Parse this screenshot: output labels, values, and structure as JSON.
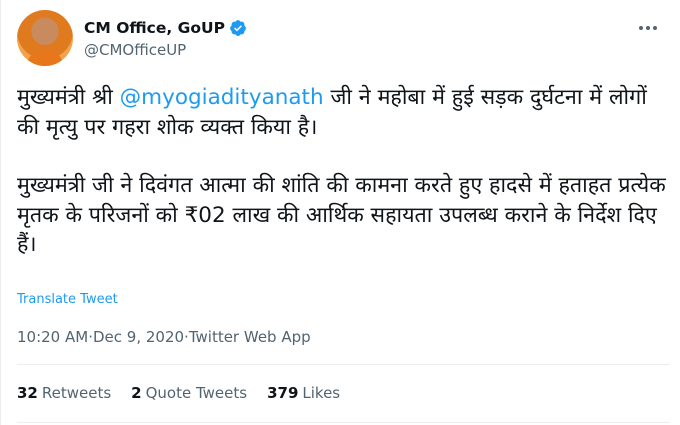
{
  "tweet": {
    "display_name": "CM Office, GoUP",
    "handle": "@CMOfficeUP",
    "more_icon": "more-options-icon",
    "para1_before": "मुख्यमंत्री श्री ",
    "para1_mention": "@myogiadityanath",
    "para1_after": " जी ने महोबा में हुई सड़क दुर्घटना में लोगों की मृत्यु पर गहरा शोक व्यक्त किया है।",
    "para2": "मुख्यमंत्री जी ने दिवंगत आत्मा की शांति की कामना करते हुए हादसे में हताहत प्रत्येक मृतक के परिजनों को ₹02 लाख की आर्थिक सहायता उपलब्ध कराने के निर्देश दिए हैं।",
    "translate_label": "Translate Tweet",
    "time": "10:20 AM",
    "date": "Dec 9, 2020",
    "source": "Twitter Web App",
    "separator": " · "
  },
  "stats": {
    "retweets_count": "32",
    "retweets_label": "Retweets",
    "quotes_count": "2",
    "quotes_label": "Quote Tweets",
    "likes_count": "379",
    "likes_label": "Likes"
  },
  "colors": {
    "accent": "#1d9bf0",
    "secondary_text": "#536471",
    "primary_text": "#0f1419"
  }
}
